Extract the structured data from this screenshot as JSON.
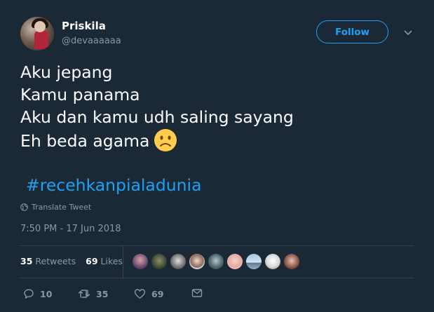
{
  "user": {
    "name": "Priskila",
    "handle": "@devaaaaaa"
  },
  "follow_label": "Follow",
  "tweet": {
    "lines": [
      "Aku jepang",
      "Kamu panama",
      "Aku dan kamu udh saling sayang",
      "Eh beda agama"
    ],
    "emoji": "sad-face-emoji",
    "hashtag": "#recehkanpialadunia"
  },
  "translate_label": "Translate Tweet",
  "timestamp": "7:50 PM - 17 Jun 2018",
  "stats": {
    "retweets_count": "35",
    "retweets_label": "Retweets",
    "likes_count": "69",
    "likes_label": "Likes"
  },
  "liker_avatars": 9,
  "actions": {
    "reply_count": "10",
    "retweet_count": "35",
    "like_count": "69"
  },
  "colors": {
    "background": "#1b2836",
    "accent": "#1da1f2",
    "muted": "#8899a6",
    "divider": "#38444d"
  },
  "icons": [
    "chevron-down-icon",
    "globe-icon",
    "reply-icon",
    "retweet-icon",
    "heart-icon",
    "message-icon"
  ]
}
